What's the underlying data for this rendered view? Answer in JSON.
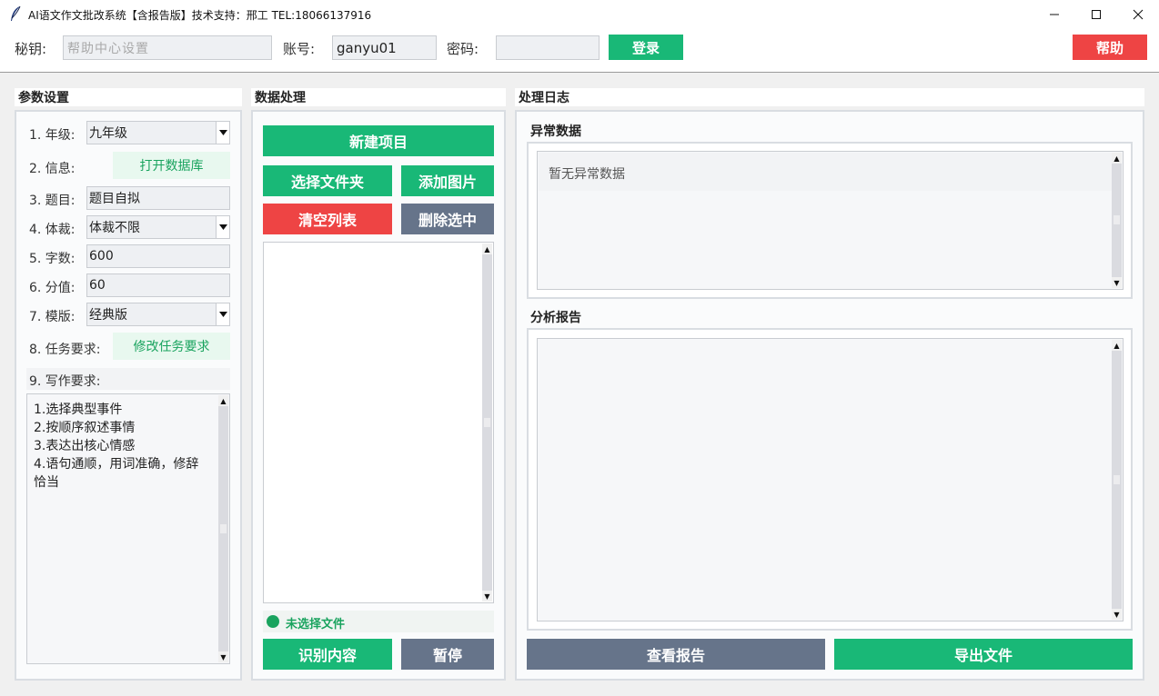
{
  "window": {
    "title": "AI语文作文批改系统【含报告版】技术支持：邢工 TEL:18066137916",
    "minimize_icon": "minimize-icon",
    "maximize_icon": "maximize-icon",
    "close_icon": "close-icon"
  },
  "login_bar": {
    "secret_label": "秘钥:",
    "secret_placeholder": "帮助中心设置",
    "account_label": "账号:",
    "account_value": "ganyu01",
    "password_label": "密码:",
    "password_value": "",
    "login_button": "登录",
    "help_button": "帮助"
  },
  "params": {
    "section_title": "参数设置",
    "grade_label": "1. 年级:",
    "grade_value": "九年级",
    "info_label": "2. 信息:",
    "info_link": "打开数据库",
    "topic_label": "3. 题目:",
    "topic_value": "题目自拟",
    "genre_label": "4. 体裁:",
    "genre_value": "体裁不限",
    "words_label": "5. 字数:",
    "words_value": "600",
    "score_label": "6. 分值:",
    "score_value": "60",
    "template_label": "7. 模版:",
    "template_value": "经典版",
    "task_label": "8. 任务要求:",
    "task_link": "修改任务要求",
    "writing_label": "9. 写作要求:",
    "writing_lines": [
      "1.选择典型事件",
      "2.按顺序叙述事情",
      "3.表达出核心情感",
      "4.语句通顺，用词准确，修辞",
      "恰当"
    ]
  },
  "data_processing": {
    "section_title": "数据处理",
    "new_project": "新建项目",
    "select_folder": "选择文件夹",
    "add_image": "添加图片",
    "clear_list": "清空列表",
    "delete_selected": "删除选中",
    "status_text": "未选择文件",
    "status_color": "#19a35e",
    "recognize": "识别内容",
    "pause": "暂停"
  },
  "log": {
    "section_title": "处理日志",
    "anomaly_title": "异常数据",
    "anomaly_empty": "暂无异常数据",
    "report_title": "分析报告",
    "view_report": "查看报告",
    "export_file": "导出文件"
  },
  "colors": {
    "green": "#19b877",
    "red": "#ee4444",
    "slate": "#66748a"
  }
}
